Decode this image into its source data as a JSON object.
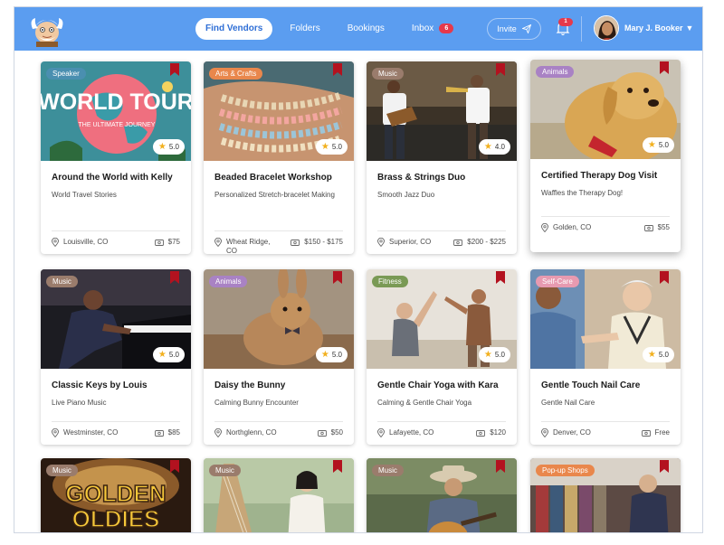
{
  "nav": {
    "items": [
      {
        "label": "Find Vendors",
        "active": true
      },
      {
        "label": "Folders",
        "active": false
      },
      {
        "label": "Bookings",
        "active": false
      },
      {
        "label": "Inbox",
        "active": false,
        "badge": "6"
      }
    ]
  },
  "header": {
    "invite_label": "Invite",
    "notification_count": "1",
    "user_name": "Mary J. Booker",
    "user_caret": "▼"
  },
  "colors": {
    "header_bg": "#5b9df0",
    "active_nav_text": "#2f6fd6",
    "badge_red": "#e6394b",
    "bookmark_red": "#b3121f",
    "star": "#f2b01e"
  },
  "rating_star": "★",
  "cards": [
    {
      "tag": "Speaker",
      "tag_color": "#4a8fb0",
      "rating": "5.0",
      "title": "Around the World with Kelly",
      "subtitle": "World Travel Stories",
      "location": "Louisville, CO",
      "price": "$75",
      "image_text": [
        "WORLD TOUR",
        "THE ULTIMATE JOURNEY"
      ]
    },
    {
      "tag": "Arts & Crafts",
      "tag_color": "#e9874c",
      "rating": "5.0",
      "title": "Beaded Bracelet Workshop",
      "subtitle": "Personalized Stretch-bracelet Making",
      "location": "Wheat Ridge, CO",
      "price": "$150 - $175"
    },
    {
      "tag": "Music",
      "tag_color": "#9a7c6c",
      "rating": "4.0",
      "title": "Brass & Strings Duo",
      "subtitle": "Smooth Jazz Duo",
      "location": "Superior, CO",
      "price": "$200 - $225"
    },
    {
      "tag": "Animals",
      "tag_color": "#a982c4",
      "rating": "5.0",
      "title": "Certified Therapy Dog Visit",
      "subtitle": "Waffles the Therapy Dog!",
      "location": "Golden, CO",
      "price": "$55"
    },
    {
      "tag": "Music",
      "tag_color": "#9a7c6c",
      "rating": "5.0",
      "title": "Classic Keys by Louis",
      "subtitle": "Live Piano Music",
      "location": "Westminster, CO",
      "price": "$85"
    },
    {
      "tag": "Animals",
      "tag_color": "#a982c4",
      "rating": "5.0",
      "title": "Daisy the Bunny",
      "subtitle": "Calming Bunny Encounter",
      "location": "Northglenn, CO",
      "price": "$50"
    },
    {
      "tag": "Fitness",
      "tag_color": "#7a9a55",
      "rating": "5.0",
      "title": "Gentle Chair Yoga with Kara",
      "subtitle": "Calming & Gentle Chair Yoga",
      "location": "Lafayette, CO",
      "price": "$120"
    },
    {
      "tag": "Self-Care",
      "tag_color": "#e79ab0",
      "rating": "5.0",
      "title": "Gentle Touch Nail Care",
      "subtitle": "Gentle Nail Care",
      "location": "Denver, CO",
      "price": "Free"
    },
    {
      "tag": "Music",
      "tag_color": "#9a7c6c",
      "image_text": [
        "GOLDEN",
        "OLDIES"
      ]
    },
    {
      "tag": "Music",
      "tag_color": "#9a7c6c"
    },
    {
      "tag": "Music",
      "tag_color": "#9a7c6c"
    },
    {
      "tag": "Pop-up Shops",
      "tag_color": "#e9874c"
    }
  ]
}
